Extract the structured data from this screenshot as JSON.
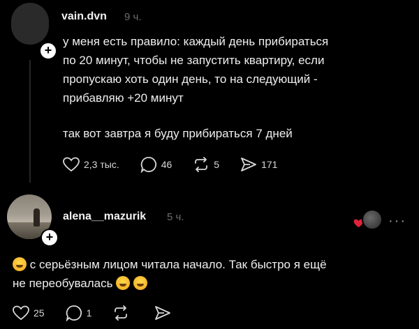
{
  "posts": [
    {
      "username": "vain.dvn",
      "time": "9 ч.",
      "lines": [
        "у меня есть правило: каждый день прибираться",
        "по 20 минут, чтобы не запустить квартиру, если",
        "пропускаю хоть один день, то на следующий -",
        "прибавляю +20 минут"
      ],
      "line2": "так вот завтра я буду прибираться 7 дней",
      "likes": "2,3 тыс.",
      "comments": "46",
      "reposts": "5",
      "shares": "171"
    },
    {
      "username": "alena__mazurik",
      "time": "5 ч.",
      "lines": [
        "с серьёзным лицом читала начало. Так быстро я ещё",
        "не переобувалась"
      ],
      "likes": "25",
      "comments": "1"
    }
  ],
  "colors": {
    "background": "#000000",
    "text": "#efefef",
    "muted": "#6e6e6e",
    "heart": "#e0233a"
  }
}
